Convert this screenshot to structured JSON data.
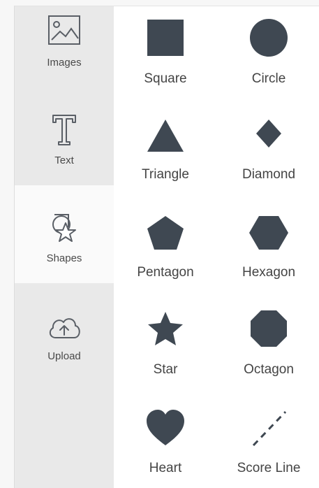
{
  "sidebar": {
    "items": [
      {
        "label": "Images",
        "icon": "images-icon"
      },
      {
        "label": "Text",
        "icon": "text-icon"
      },
      {
        "label": "Shapes",
        "icon": "shapes-icon"
      },
      {
        "label": "Upload",
        "icon": "upload-icon"
      }
    ],
    "active": "Shapes"
  },
  "shapes": [
    {
      "label": "Square"
    },
    {
      "label": "Circle"
    },
    {
      "label": "Triangle"
    },
    {
      "label": "Diamond"
    },
    {
      "label": "Pentagon"
    },
    {
      "label": "Hexagon"
    },
    {
      "label": "Star"
    },
    {
      "label": "Octagon"
    },
    {
      "label": "Heart"
    },
    {
      "label": "Score Line"
    }
  ],
  "colors": {
    "shape_fill": "#3f4852",
    "rail_bg": "#e9e9e9",
    "active_bg": "#fafafa"
  }
}
